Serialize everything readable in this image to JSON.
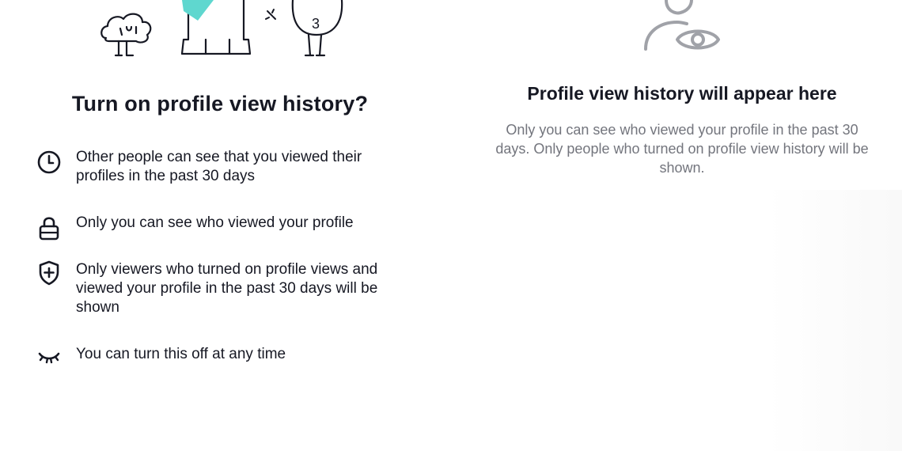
{
  "optin": {
    "title": "Turn on profile view history?",
    "features": [
      {
        "icon": "clock-icon",
        "text": "Other people can see that you viewed their profiles in the past 30 days"
      },
      {
        "icon": "lock-icon",
        "text": "Only you can see who viewed your profile"
      },
      {
        "icon": "shield-plus-icon",
        "text": "Only viewers who turned on profile views and viewed your profile in the past 30 days will be shown"
      },
      {
        "icon": "closed-eye-icon",
        "text": "You can turn this off at any time"
      }
    ],
    "illustration_badge": "3"
  },
  "empty_state": {
    "icon": "profile-eye-icon",
    "title": "Profile view history will appear here",
    "description": "Only you can see who viewed your profile in the past 30 days. Only people who turned on profile view history will be shown."
  },
  "colors": {
    "text": "#161823",
    "muted": "#73757d",
    "icon_gray": "#a0a2a8",
    "accent_teal": "#5fd7cf"
  }
}
